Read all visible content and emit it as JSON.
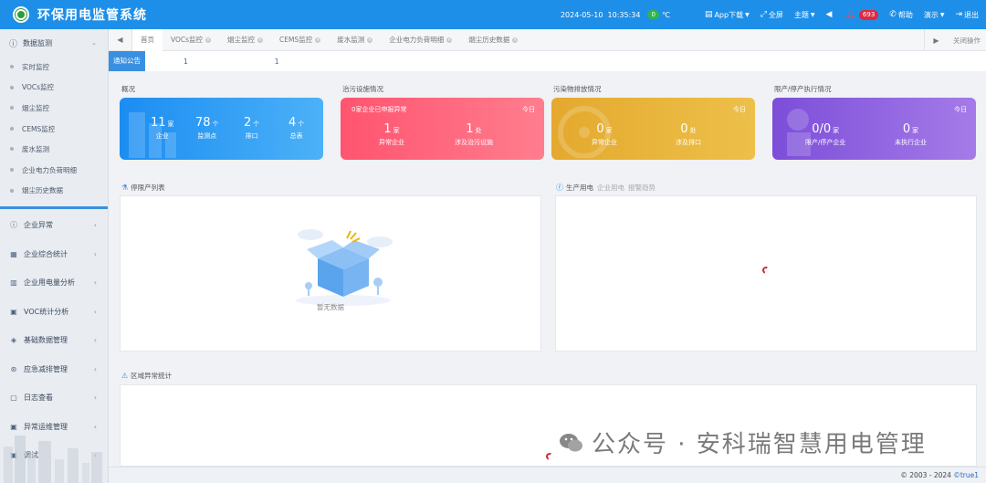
{
  "header": {
    "title": "环保用电监管系统",
    "date": "2024-05-10",
    "time": "10:35:34",
    "temp_value": "0",
    "temp_unit": "℃",
    "app_download": "App下载",
    "fullscreen": "全屏",
    "theme": "主题",
    "notify_count": "693",
    "help": "帮助",
    "demo": "演示",
    "logout": "退出"
  },
  "sidebar": {
    "group_open": {
      "label": "数据监测",
      "items": [
        "实时监控",
        "VOCs监控",
        "烟尘监控",
        "CEMS监控",
        "废水监测",
        "企业电力负荷明细",
        "烟尘历史数据"
      ]
    },
    "items": [
      {
        "label": "企业异常",
        "icon": "alert-circle-icon"
      },
      {
        "label": "企业综合统计",
        "icon": "building-icon"
      },
      {
        "label": "企业用电量分析",
        "icon": "bar-chart-icon"
      },
      {
        "label": "VOC统计分析",
        "icon": "calendar-icon"
      },
      {
        "label": "基础数据管理",
        "icon": "layers-icon"
      },
      {
        "label": "应急减排管理",
        "icon": "emergency-icon"
      },
      {
        "label": "日志查看",
        "icon": "log-icon"
      },
      {
        "label": "异常运维管理",
        "icon": "calendar-icon"
      },
      {
        "label": "调试",
        "icon": "calendar-icon"
      }
    ]
  },
  "tabs": {
    "items": [
      "首页",
      "VOCs监控",
      "烟尘监控",
      "CEMS监控",
      "废水监测",
      "企业电力负荷明细",
      "烟尘历史数据"
    ],
    "close_ops": "关闭操作"
  },
  "notice": {
    "label": "通知公告",
    "items": [
      "1",
      "1"
    ]
  },
  "sections": {
    "overview": "概况",
    "facility": "治污设施情况",
    "emission": "污染物排放情况",
    "limit": "限产/停产执行情况"
  },
  "cards": {
    "overview": {
      "metrics": [
        {
          "num": "11",
          "unit": "家",
          "label": "企业"
        },
        {
          "num": "78",
          "unit": "个",
          "label": "监测点"
        },
        {
          "num": "2",
          "unit": "个",
          "label": "排口"
        },
        {
          "num": "4",
          "unit": "个",
          "label": "总表"
        }
      ]
    },
    "facility": {
      "top": "0家企业已申报异常",
      "today": "今日",
      "metrics": [
        {
          "num": "1",
          "unit": "家",
          "label": "异常企业"
        },
        {
          "num": "1",
          "unit": "处",
          "label": "涉及治污设施"
        }
      ]
    },
    "emission": {
      "today": "今日",
      "metrics": [
        {
          "num": "0",
          "unit": "家",
          "label": "异常企业"
        },
        {
          "num": "0",
          "unit": "处",
          "label": "涉及排口"
        }
      ]
    },
    "limit": {
      "today": "今日",
      "metrics": [
        {
          "num": "0/0",
          "unit": "家",
          "label": "限产/停产企业"
        },
        {
          "num": "0",
          "unit": "家",
          "label": "未执行企业"
        }
      ]
    }
  },
  "panels": {
    "stopped_list": {
      "title": "停限产列表",
      "empty": "暂无数据"
    },
    "power": {
      "title": "生产用电",
      "tab2": "企业用电",
      "tab3": "报警趋势"
    },
    "region": {
      "title": "区域异常统计"
    }
  },
  "footer": {
    "copyright": "© 2003 - 2024 ",
    "brand": "©true1"
  },
  "watermark": {
    "text": "公众号 · 安科瑞智慧用电管理"
  },
  "colors": {
    "primary": "#1e8fe8",
    "card_blue": "#1b8df2",
    "card_red": "#ff5470",
    "card_yellow": "#e4a92e",
    "card_purple": "#7c4ed9",
    "badge_green": "#2db64b",
    "badge_red": "#e0283e"
  }
}
